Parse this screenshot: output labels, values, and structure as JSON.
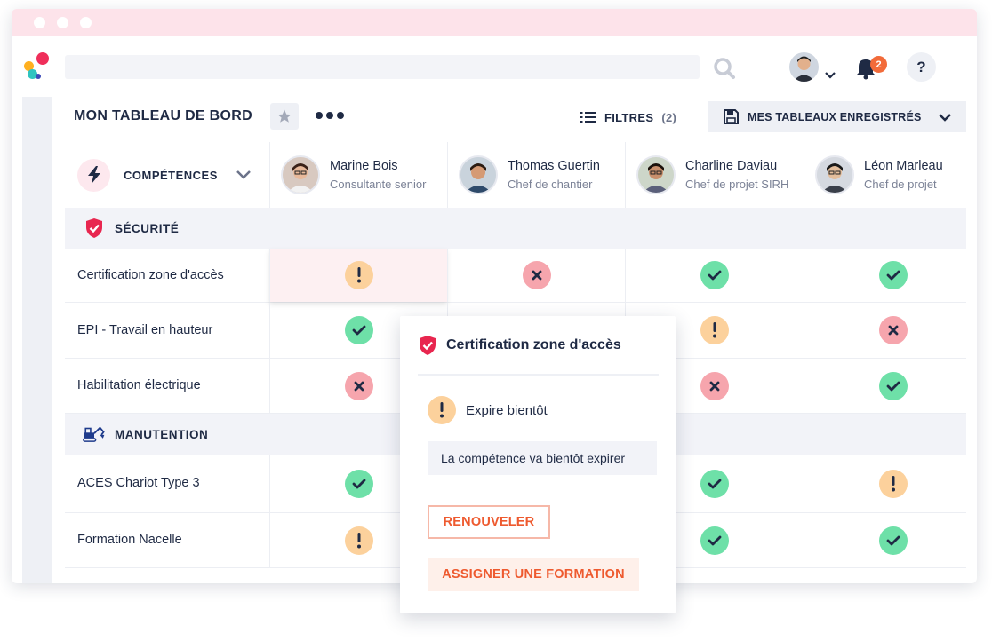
{
  "colors": {
    "accent": "#ee5a2f",
    "ok": "#6ee0a8",
    "ko": "#f6a5ad",
    "warn": "#fcd19c",
    "security": "#e8264f",
    "manutention": "#1f3b8c"
  },
  "topbar": {
    "notifications_count": "2",
    "help_label": "?"
  },
  "toolbar": {
    "title": "MON TABLEAU DE BORD",
    "filters_label": "FILTRES",
    "filters_count": "(2)",
    "saved_label": "MES TABLEAUX ENREGISTRÉS"
  },
  "grid": {
    "skills_header": "COMPÉTENCES",
    "people": [
      {
        "name": "Marine Bois",
        "role": "Consultante senior"
      },
      {
        "name": "Thomas Guertin",
        "role": "Chef de chantier"
      },
      {
        "name": "Charline Daviau",
        "role": "Chef de projet SIRH"
      },
      {
        "name": "Léon Marleau",
        "role": "Chef de projet"
      }
    ],
    "sections": [
      {
        "label": "SÉCURITÉ",
        "icon": "shield-check-icon",
        "skills": [
          {
            "name": "Certification zone d'accès",
            "statuses": [
              "warn",
              "ko",
              "ok",
              "ok"
            ]
          },
          {
            "name": "EPI - Travail en hauteur",
            "statuses": [
              "ok",
              "",
              "warn",
              "ko"
            ]
          },
          {
            "name": "Habilitation électrique",
            "statuses": [
              "ko",
              "",
              "ko",
              "ok"
            ]
          }
        ]
      },
      {
        "label": "MANUTENTION",
        "icon": "excavator-icon",
        "skills": [
          {
            "name": "ACES Chariot Type 3",
            "statuses": [
              "ok",
              "",
              "ok",
              "warn"
            ]
          },
          {
            "name": "Formation Nacelle",
            "statuses": [
              "warn",
              "",
              "ok",
              "ok"
            ]
          }
        ]
      }
    ]
  },
  "popover": {
    "title": "Certification zone d'accès",
    "status_label": "Expire bientôt",
    "description": "La compétence va bientôt expirer",
    "renew_label": "RENOUVELER",
    "assign_label": "ASSIGNER UNE FORMATION"
  }
}
